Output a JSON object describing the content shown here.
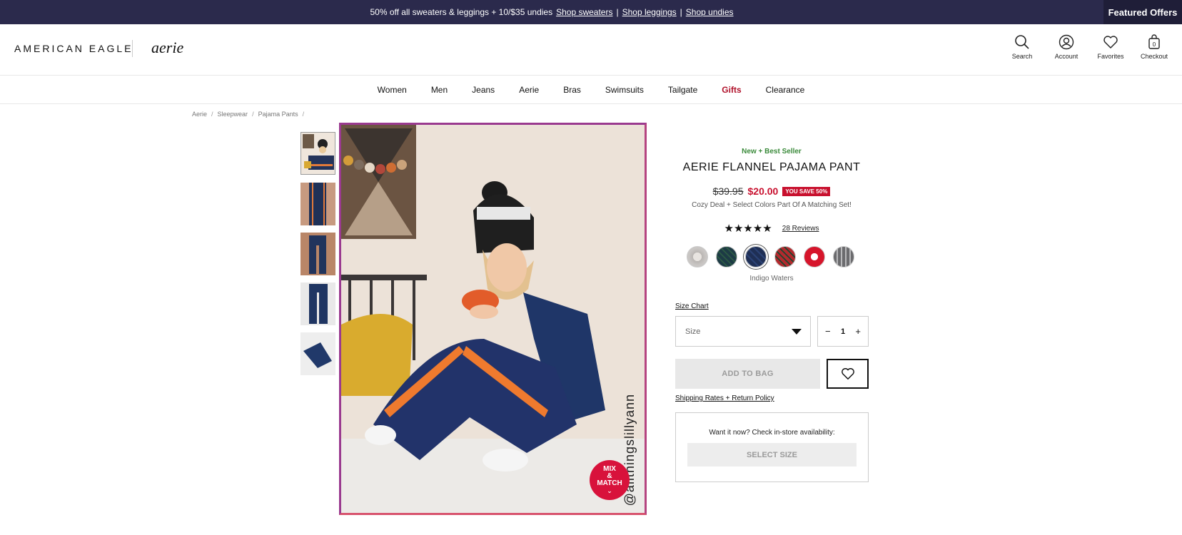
{
  "promo": {
    "text": "50% off all sweaters & leggings + 10/$35 undies",
    "links": [
      "Shop sweaters",
      "Shop leggings",
      "Shop undies"
    ],
    "separator": "|",
    "featured": "Featured Offers"
  },
  "header": {
    "logo_ae": "AMERICAN EAGLE",
    "logo_aerie": "aerie",
    "icons": [
      {
        "icon": "search-icon",
        "label": "Search"
      },
      {
        "icon": "account-icon",
        "label": "Account"
      },
      {
        "icon": "heart-icon",
        "label": "Favorites"
      },
      {
        "icon": "bag-icon",
        "label": "Checkout",
        "count": "0"
      }
    ]
  },
  "nav": [
    "Women",
    "Men",
    "Jeans",
    "Aerie",
    "Bras",
    "Swimsuits",
    "Tailgate",
    "Gifts",
    "Clearance"
  ],
  "breadcrumb": [
    "Aerie",
    "Sleepwear",
    "Pajama Pants"
  ],
  "image": {
    "watermark": "@allthingslillyann",
    "mix_match": [
      "MIX",
      "&",
      "MATCH"
    ]
  },
  "product": {
    "badge": "New + Best Seller",
    "title": "AERIE FLANNEL PAJAMA PANT",
    "old_price": "$39.95",
    "new_price": "$20.00",
    "save_badge": "YOU SAVE 50%",
    "deal": "Cozy Deal + Select Colors Part Of A Matching Set!",
    "rating": 4.5,
    "stars": "★★★★★",
    "reviews": "28 Reviews",
    "swatch_colors": [
      "#c9c6c4",
      "#1d3b45",
      "#1f2f55",
      "#b32a2e",
      "#d6152b",
      "#6b6b6e"
    ],
    "selected_color": "Indigo Waters",
    "size_chart": "Size Chart",
    "size_placeholder": "Size",
    "qty_minus": "−",
    "qty_value": "1",
    "qty_plus": "+",
    "add_to_bag": "ADD TO BAG",
    "shipping": "Shipping Rates + Return Policy",
    "store_text": "Want it now? Check in-store availability:",
    "select_size": "SELECT SIZE"
  },
  "colors": {
    "promo_bg": "#2b2a4c",
    "accent_red": "#c8102e",
    "badge_green": "#3a8a3a"
  }
}
